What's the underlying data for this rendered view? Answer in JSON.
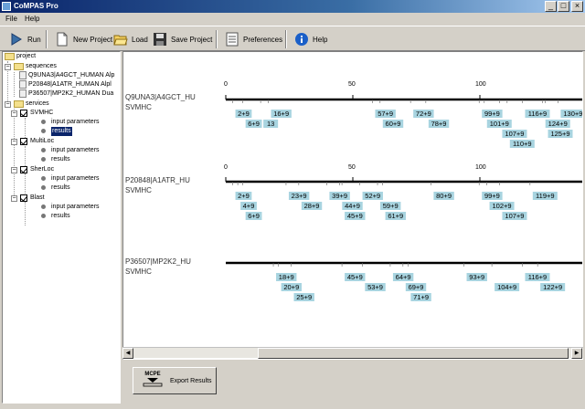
{
  "window": {
    "title": "CoMPAS Pro"
  },
  "menu": {
    "items": [
      "File",
      "Help"
    ]
  },
  "toolbar": {
    "run": "Run",
    "new_project": "New Project",
    "load": "Load",
    "save_project": "Save Project",
    "preferences": "Preferences",
    "help": "Help"
  },
  "tree": {
    "root": "project",
    "sequences_label": "sequences",
    "sequences": [
      "Q9UNA3|A4GCT_HUMAN Alp",
      "P20848|A1ATR_HUMAN Alpl",
      "P36507|MP2K2_HUMAN Dua"
    ],
    "services_label": "services",
    "services": [
      {
        "name": "SVMHC",
        "children": [
          "input parameters",
          "results"
        ]
      },
      {
        "name": "MultiLoc",
        "children": [
          "input parameters",
          "results"
        ]
      },
      {
        "name": "SherLoc",
        "children": [
          "input parameters",
          "results"
        ]
      },
      {
        "name": "Blast",
        "children": [
          "input parameters",
          "results"
        ]
      }
    ]
  },
  "results": [
    {
      "sequence": "Q9UNA3|A4GCT_HU",
      "method": "SVMHC",
      "ticks": [
        "0",
        "50",
        "100"
      ],
      "epitopes": [
        "2+9",
        "6+9",
        "16+9",
        "57+9",
        "60+9",
        "72+9",
        "78+9",
        "99+9",
        "101+9",
        "107+9",
        "110+9",
        "116+9",
        "124+9",
        "125+9",
        "130+9",
        "13"
      ]
    },
    {
      "sequence": "P20848|A1ATR_HU",
      "method": "SVMHC",
      "ticks": [
        "0",
        "50",
        "100"
      ],
      "epitopes": [
        "2+9",
        "4+9",
        "6+9",
        "23+9",
        "28+9",
        "39+9",
        "44+9",
        "45+9",
        "52+9",
        "59+9",
        "61+9",
        "80+9",
        "99+9",
        "102+9",
        "107+9",
        "119+9"
      ]
    },
    {
      "sequence": "P36507|MP2K2_HU",
      "method": "SVMHC",
      "ticks": [],
      "epitopes": [
        "18+9",
        "20+9",
        "25+9",
        "45+9",
        "53+9",
        "64+9",
        "69+9",
        "71+9",
        "93+9",
        "104+9",
        "116+9",
        "122+9"
      ]
    }
  ],
  "export": {
    "badge": "MCPE",
    "label": "Export Results"
  },
  "colors": {
    "epitope_fill": "#a8d4e0",
    "title_bar": "#0a246a",
    "selection": "#0a246a"
  }
}
